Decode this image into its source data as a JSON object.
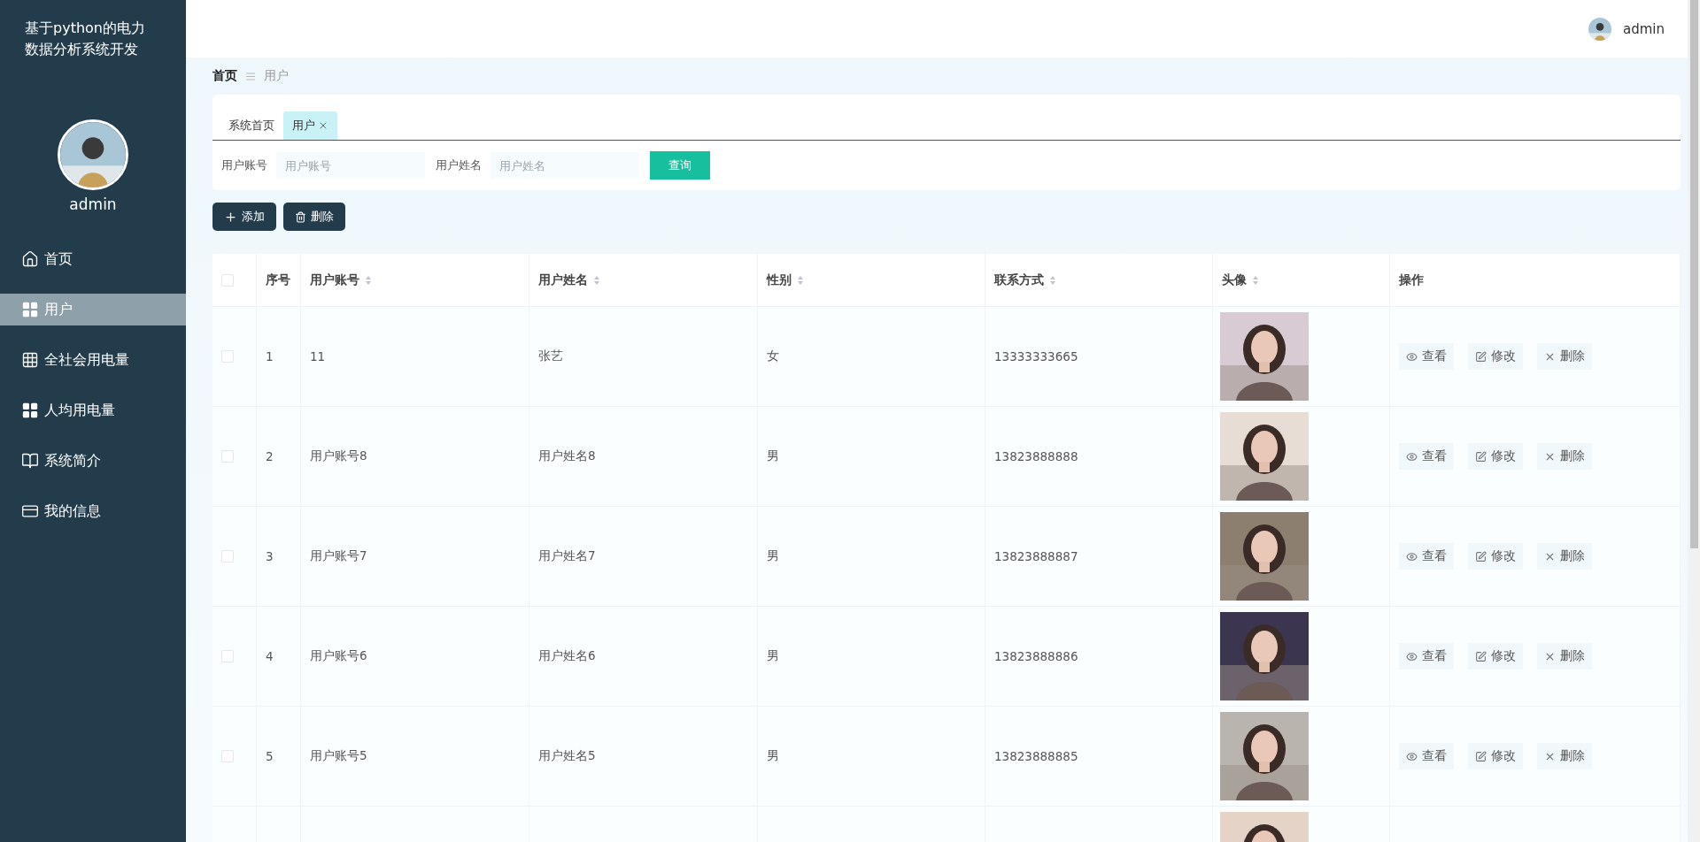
{
  "sidebar": {
    "title": "基于python的电力数据分析系统开发",
    "user": "admin",
    "items": [
      {
        "label": "首页",
        "kind": "home",
        "selected": false
      },
      {
        "label": "用户",
        "kind": "grid4",
        "selected": true
      },
      {
        "label": "全社会用电量",
        "kind": "grid9",
        "selected": false
      },
      {
        "label": "人均用电量",
        "kind": "grid4",
        "selected": false
      },
      {
        "label": "系统简介",
        "kind": "book",
        "selected": false
      },
      {
        "label": "我的信息",
        "kind": "card",
        "selected": false
      }
    ]
  },
  "header": {
    "user": "admin"
  },
  "breadcrumb": [
    "首页",
    "用户"
  ],
  "tabs": [
    {
      "label": "系统首页",
      "selected": false,
      "closable": false
    },
    {
      "label": "用户",
      "selected": true,
      "closable": true
    }
  ],
  "search": {
    "fields": [
      {
        "label": "用户账号",
        "placeholder": "用户账号"
      },
      {
        "label": "用户姓名",
        "placeholder": "用户姓名"
      }
    ],
    "button": "查询"
  },
  "actions": [
    {
      "label": "添加",
      "kind": "add"
    },
    {
      "label": "删除",
      "kind": "delete"
    }
  ],
  "table": {
    "select_all": {
      "checked": false
    },
    "columns": [
      {
        "label": "序号",
        "sortable": false
      },
      {
        "label": "用户账号",
        "sortable": true
      },
      {
        "label": "用户姓名",
        "sortable": true
      },
      {
        "label": "性别",
        "sortable": true
      },
      {
        "label": "联系方式",
        "sortable": true
      },
      {
        "label": "头像",
        "sortable": true
      },
      {
        "label": "操作",
        "sortable": false
      }
    ],
    "rows": [
      {
        "checked": false,
        "cells": [
          "1",
          "11",
          "张艺",
          "女",
          "13333333665"
        ],
        "avatar": {
          "kind": "picture"
        },
        "actions": [
          {
            "label": "查看",
            "kind": "view"
          },
          {
            "label": "修改",
            "kind": "edit"
          },
          {
            "label": "删除",
            "kind": "delete"
          }
        ]
      },
      {
        "checked": false,
        "cells": [
          "2",
          "用户账号8",
          "用户姓名8",
          "男",
          "13823888888"
        ],
        "avatar": {
          "kind": "picture"
        },
        "actions": [
          {
            "label": "查看",
            "kind": "view"
          },
          {
            "label": "修改",
            "kind": "edit"
          },
          {
            "label": "删除",
            "kind": "delete"
          }
        ]
      },
      {
        "checked": false,
        "cells": [
          "3",
          "用户账号7",
          "用户姓名7",
          "男",
          "13823888887"
        ],
        "avatar": {
          "kind": "picture"
        },
        "actions": [
          {
            "label": "查看",
            "kind": "view"
          },
          {
            "label": "修改",
            "kind": "edit"
          },
          {
            "label": "删除",
            "kind": "delete"
          }
        ]
      },
      {
        "checked": false,
        "cells": [
          "4",
          "用户账号6",
          "用户姓名6",
          "男",
          "13823888886"
        ],
        "avatar": {
          "kind": "picture"
        },
        "actions": [
          {
            "label": "查看",
            "kind": "view"
          },
          {
            "label": "修改",
            "kind": "edit"
          },
          {
            "label": "删除",
            "kind": "delete"
          }
        ]
      },
      {
        "checked": false,
        "cells": [
          "5",
          "用户账号5",
          "用户姓名5",
          "男",
          "13823888885"
        ],
        "avatar": {
          "kind": "picture"
        },
        "actions": [
          {
            "label": "查看",
            "kind": "view"
          },
          {
            "label": "修改",
            "kind": "edit"
          },
          {
            "label": "删除",
            "kind": "delete"
          }
        ]
      },
      {
        "avatar": {
          "kind": "picture"
        }
      }
    ]
  }
}
